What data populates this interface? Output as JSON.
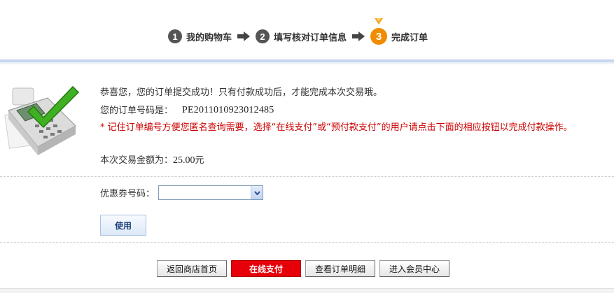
{
  "steps": [
    {
      "num": "1",
      "label": "我的购物车"
    },
    {
      "num": "2",
      "label": "填写核对订单信息"
    },
    {
      "num": "3",
      "label": "完成订单"
    }
  ],
  "message": {
    "success": "恭喜您，您的订单提交成功！只有付款成功后，才能完成本次交易哦。",
    "order_label": "您的订单号码是：",
    "order_number": "PE2011010923012485",
    "notice": "* 记住订单编号方便您匿名查询需要，选择“在线支付”或“预付款支付”的用户请点击下面的相应按钮以完成付款操作。",
    "amount_label": "本次交易金额为：",
    "amount_value": "25.00",
    "amount_unit": "元"
  },
  "coupon": {
    "label": "优惠券号码：",
    "selected": "",
    "use_label": "使用"
  },
  "actions": {
    "home": "返回商店首页",
    "pay": "在线支付",
    "detail": "查看订单明细",
    "member": "进入会员中心"
  },
  "colors": {
    "pay_button": "#e6000a",
    "notice_text": "#cc0000",
    "active_step": "#f08c00",
    "band": "#c9d6ee"
  },
  "icons": {
    "step_arrow": "arrow-right-icon",
    "active_step_badge": "medal-icon",
    "illustration": "pos-terminal-checkmark-icon",
    "dropdown": "chevron-down-icon"
  }
}
